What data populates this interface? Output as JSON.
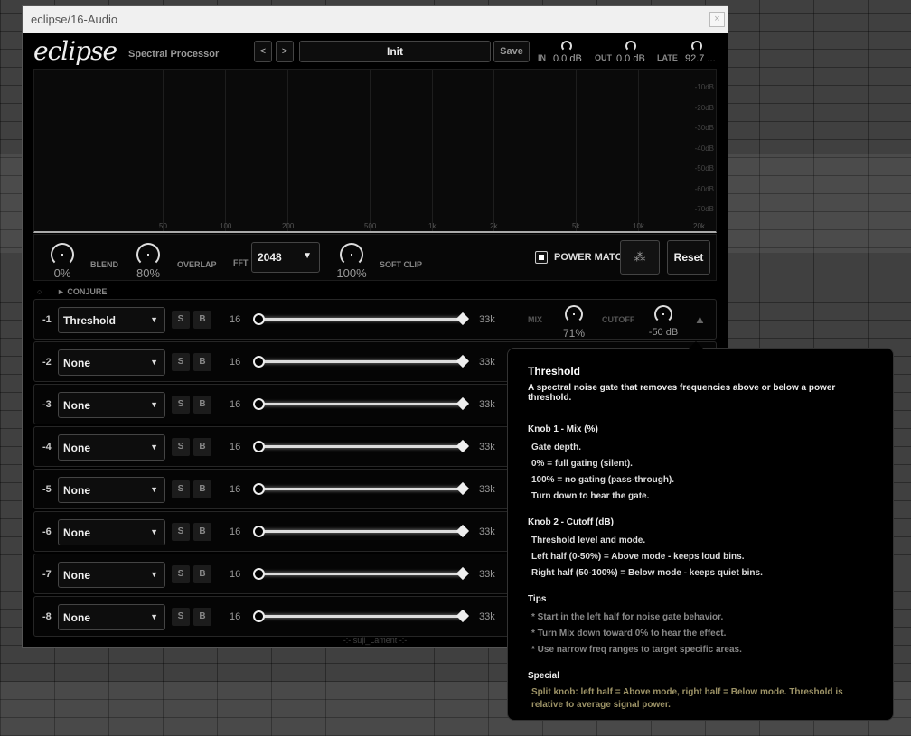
{
  "window": {
    "title": "eclipse/16-Audio",
    "close": "×"
  },
  "header": {
    "logo": "eclipse",
    "subtitle": "Spectral Processor",
    "prev": "<",
    "next": ">",
    "preset": "Init",
    "save": "Save",
    "in_label": "IN",
    "in_value": "0.0 dB",
    "out_label": "OUT",
    "out_value": "0.0 dB",
    "late_label": "LATE",
    "late_value": "92.7 ..."
  },
  "spectrum": {
    "freq_labels": [
      "50",
      "100",
      "200",
      "500",
      "1k",
      "2k",
      "5k",
      "10k",
      "20k"
    ],
    "db_labels": [
      "-10dB",
      "-20dB",
      "-30dB",
      "-40dB",
      "-50dB",
      "-60dB",
      "-70dB"
    ]
  },
  "controls": {
    "blend_label": "BLEND",
    "blend_value": "0%",
    "overlap_label": "OVERLAP",
    "overlap_value": "80%",
    "fft_label": "FFT",
    "fft_value": "2048",
    "soft_clip_label": "SOFT CLIP",
    "soft_clip_value": "100%",
    "power_match_label": "POWER MATCH",
    "power_match_checked": true,
    "dots_icon": "⁂",
    "reset": "Reset"
  },
  "conjure": {
    "dot": "○",
    "label": "► CONJURE"
  },
  "slots": [
    {
      "num": "-1",
      "effect": "Threshold",
      "s": "S",
      "b": "B",
      "lo": "16",
      "hi": "33k",
      "mix_label": "MIX",
      "mix_value": "71%",
      "cutoff_label": "CUTOFF",
      "cutoff_value": "-50 dB"
    },
    {
      "num": "-2",
      "effect": "None",
      "s": "S",
      "b": "B",
      "lo": "16",
      "hi": "33k"
    },
    {
      "num": "-3",
      "effect": "None",
      "s": "S",
      "b": "B",
      "lo": "16",
      "hi": "33k"
    },
    {
      "num": "-4",
      "effect": "None",
      "s": "S",
      "b": "B",
      "lo": "16",
      "hi": "33k"
    },
    {
      "num": "-5",
      "effect": "None",
      "s": "S",
      "b": "B",
      "lo": "16",
      "hi": "33k"
    },
    {
      "num": "-6",
      "effect": "None",
      "s": "S",
      "b": "B",
      "lo": "16",
      "hi": "33k"
    },
    {
      "num": "-7",
      "effect": "None",
      "s": "S",
      "b": "B",
      "lo": "16",
      "hi": "33k"
    },
    {
      "num": "-8",
      "effect": "None",
      "s": "S",
      "b": "B",
      "lo": "16",
      "hi": "33k"
    }
  ],
  "footer": "-:- suji_Lament -:-",
  "tooltip": {
    "title": "Threshold",
    "description": "A spectral noise gate that removes frequencies above or below a power threshold.",
    "knob1_head": "Knob 1 - Mix (%)",
    "knob1_lines": [
      "Gate depth.",
      "0% = full gating (silent).",
      "100% = no gating (pass-through).",
      "Turn down to hear the gate."
    ],
    "knob2_head": "Knob 2 - Cutoff (dB)",
    "knob2_lines": [
      "Threshold level and mode.",
      "Left half (0-50%) = Above mode - keeps loud bins.",
      "Right half (50-100%) = Below mode - keeps quiet bins."
    ],
    "tips_head": "Tips",
    "tips_lines": [
      "* Start in the left half for noise gate behavior.",
      "* Turn Mix down toward 0% to hear the effect.",
      "* Use narrow freq ranges to target specific areas."
    ],
    "special_head": "Special",
    "special_text": "Split knob: left half = Above mode, right half = Below mode. Threshold is relative to average signal power."
  }
}
